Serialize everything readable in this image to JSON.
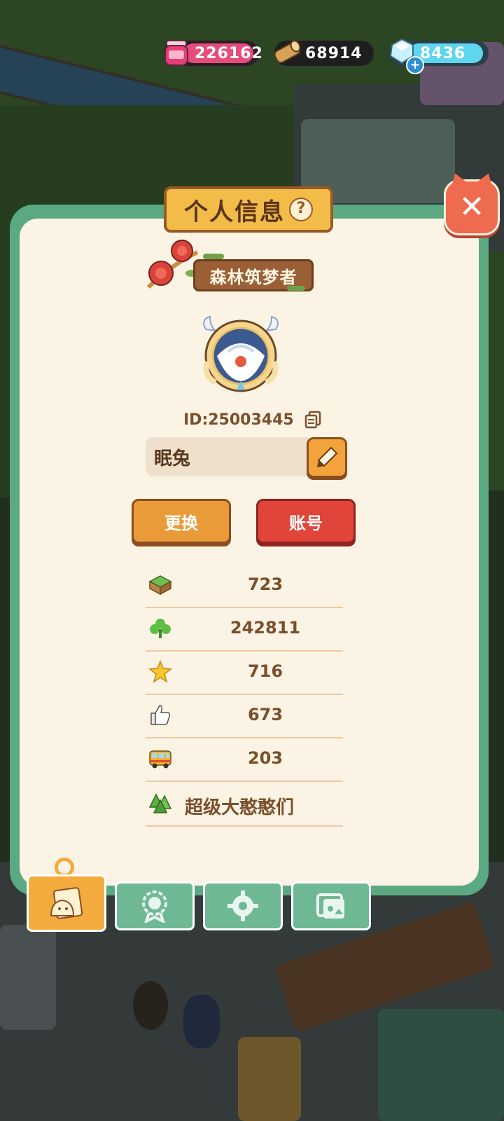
{
  "currency": {
    "jam": {
      "value": "226162",
      "icon": "jam-jar-icon",
      "color": "#e84c7c"
    },
    "wood": {
      "value": "68914",
      "icon": "wood-log-icon"
    },
    "gem": {
      "value": "8436",
      "icon": "diamond-icon",
      "color": "#5ed6f0"
    }
  },
  "panel": {
    "title": "个人信息",
    "help_symbol": "?",
    "close_symbol": "✕"
  },
  "profile": {
    "title_badge": "森林筑梦者",
    "id_text": "ID:25003445",
    "nickname": "眠兔",
    "change_label": "更换",
    "account_label": "账号"
  },
  "stats": [
    {
      "icon": "grass-block-icon",
      "value": "723"
    },
    {
      "icon": "clover-icon",
      "value": "242811"
    },
    {
      "icon": "star-icon",
      "value": "716"
    },
    {
      "icon": "thumbs-up-icon",
      "value": "673"
    },
    {
      "icon": "bus-icon",
      "value": "203"
    },
    {
      "icon": "tree-icon",
      "value": "超级大憨憨们"
    }
  ],
  "tabs": [
    "profile-card",
    "badge",
    "settings-gear",
    "photo-album"
  ]
}
